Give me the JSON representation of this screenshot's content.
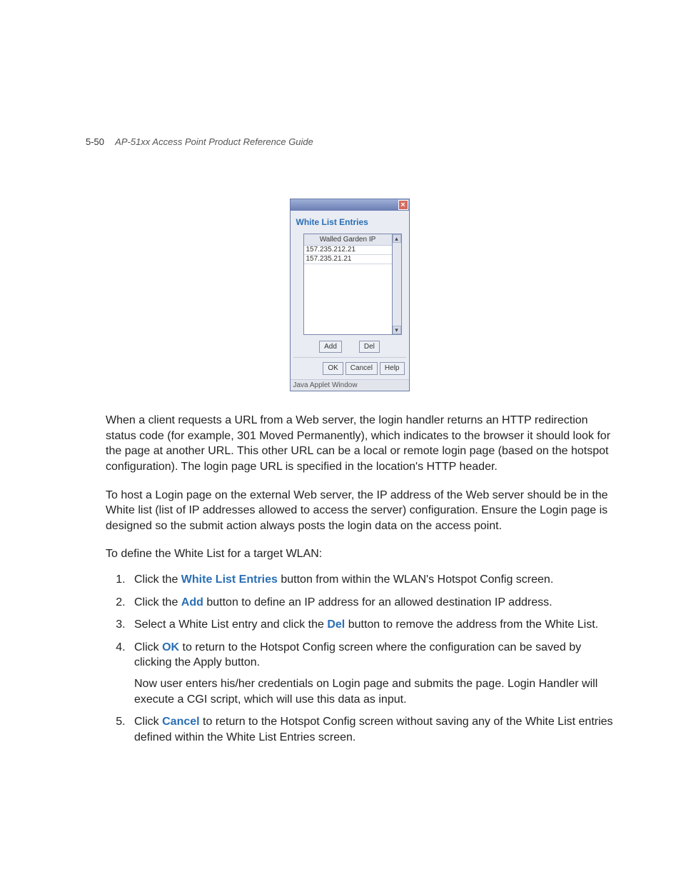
{
  "header": {
    "page_number": "5-50",
    "guide_title": "AP-51xx Access Point Product Reference Guide"
  },
  "dialog": {
    "title": "White List Entries",
    "close_glyph": "×",
    "column_header": "Walled Garden IP",
    "rows": [
      "157.235.212.21",
      "157.235.21.21"
    ],
    "scroll_up": "▴",
    "scroll_down": "▾",
    "add_label": "Add",
    "del_label": "Del",
    "ok_label": "OK",
    "cancel_label": "Cancel",
    "help_label": "Help",
    "status": "Java Applet Window"
  },
  "body": {
    "p1": "When a client requests a URL from a Web server, the login handler returns an HTTP redirection status code (for example, 301 Moved Permanently), which indicates to the browser it should look for the page at another URL. This other URL can be a local or remote login page (based on the hotspot configuration). The login page URL is specified in the location's HTTP header.",
    "p2": "To host a Login page on the external Web server, the IP address of the Web server should be in the White list (list of IP addresses allowed to access the server) configuration. Ensure the Login page is designed so the submit action always posts the login data on the access point.",
    "p3": "To define the White List for a target WLAN:"
  },
  "steps": {
    "s1a": "Click the ",
    "s1kw": "White List Entries",
    "s1b": " button from within the WLAN's Hotspot Config screen.",
    "s2a": "Click the ",
    "s2kw": "Add",
    "s2b": " button to define an IP address for an allowed destination IP address.",
    "s3a": "Select a White List entry and click the ",
    "s3kw": "Del",
    "s3b": " button to remove the address from the White List.",
    "s4a": "Click ",
    "s4kw": "OK",
    "s4b": " to return to the Hotspot Config screen where the configuration can be saved by clicking the Apply button.",
    "s4sub": "Now user enters his/her credentials on Login page and submits the page. Login Handler will execute a CGI script, which will use this data as input.",
    "s5a": "Click ",
    "s5kw": "Cancel",
    "s5b": " to return to the Hotspot Config screen without saving any of the White List entries defined within the White List Entries screen."
  }
}
